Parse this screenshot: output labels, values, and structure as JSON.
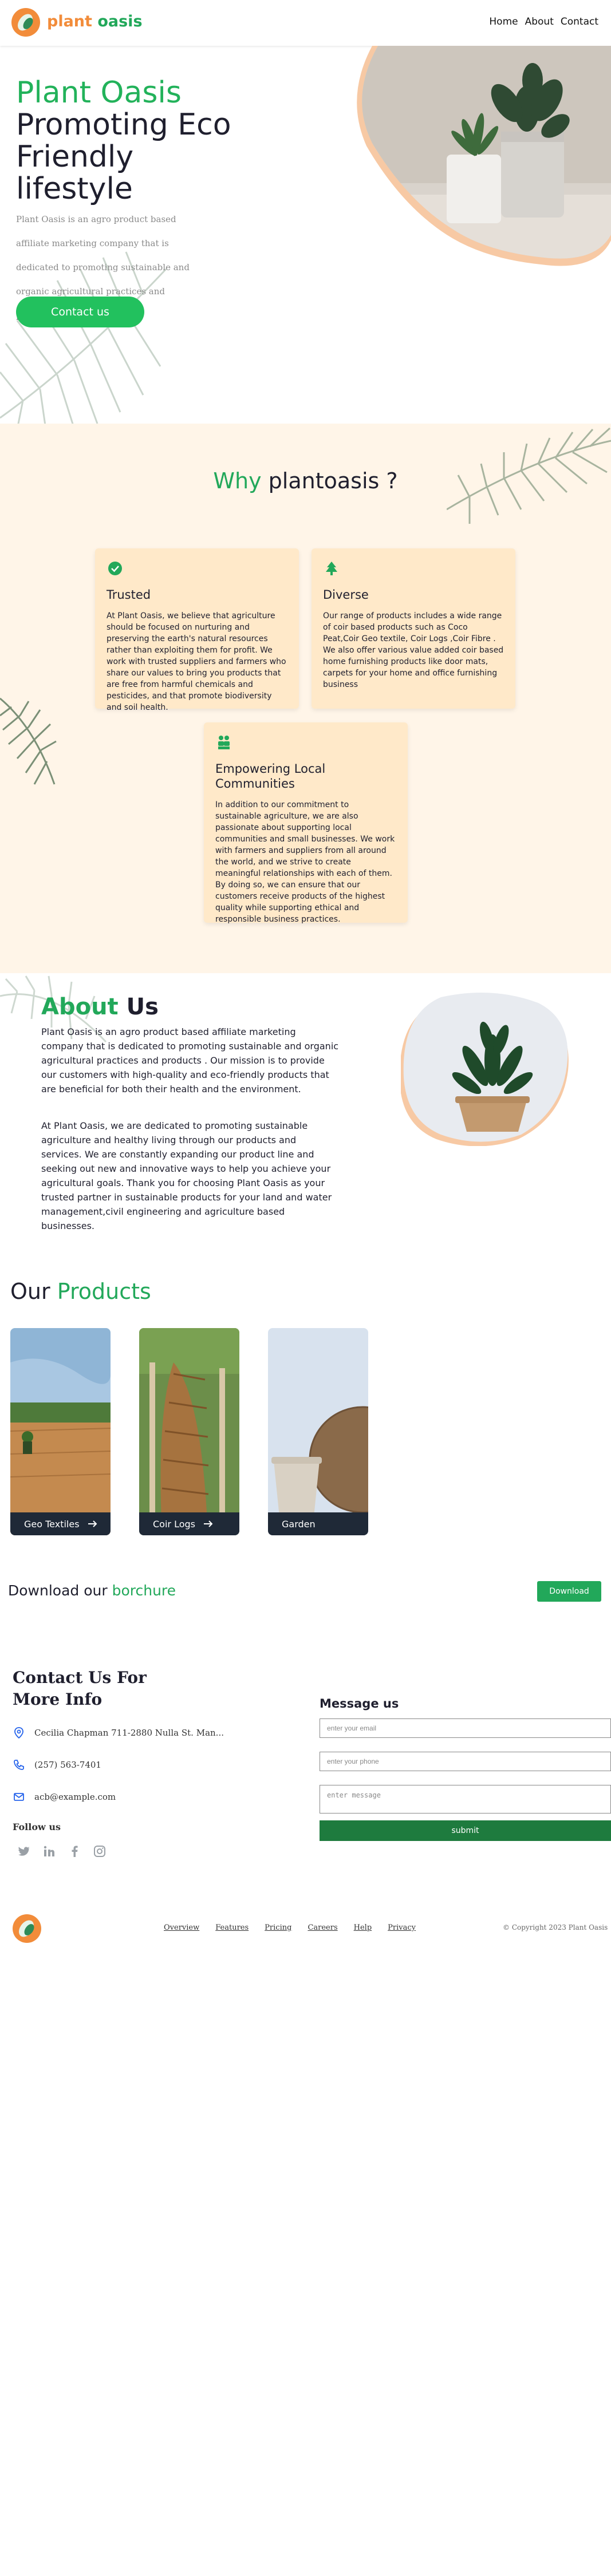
{
  "header": {
    "brand_part1": "plant",
    "brand_part2": "oasis",
    "nav": [
      "Home",
      "About",
      "Contact"
    ]
  },
  "hero": {
    "title_green": "Plant Oasis",
    "title_dark": "Promoting Eco Friendly lifestyle",
    "description": "Plant Oasis is an agro product based affiliate marketing company that is dedicated to promoting sustainable and organic agricultural practices and products .",
    "button": "Contact us"
  },
  "why": {
    "title_green": "Why",
    "title_dark": "plantoasis ?",
    "cards": [
      {
        "icon": "check-circle-icon",
        "title": "Trusted",
        "text": "At Plant Oasis, we believe that agriculture should be focused on nurturing and preserving the earth's natural resources rather than exploiting them for profit. We work with trusted suppliers and farmers who share our values to bring you products that are free from harmful chemicals and pesticides, and that promote biodiversity and soil health."
      },
      {
        "icon": "tree-icon",
        "title": "Diverse",
        "text": "Our range of products includes a wide range of coir based products such as Coco Peat,Coir Geo textile, Coir Logs ,Coir Fibre . We also offer various value added coir based home furnishing products like door mats, carpets for your home and office furnishing business"
      },
      {
        "icon": "people-icon",
        "title": "Empowering Local Communities",
        "text": "In addition to our commitment to sustainable agriculture, we are also passionate about supporting local communities and small businesses. We work with farmers and suppliers from all around the world, and we strive to create meaningful relationships with each of them. By doing so, we can ensure that our customers receive products of the highest quality while supporting ethical and responsible business practices."
      }
    ]
  },
  "about": {
    "title_green": "About",
    "title_dark": "Us",
    "para1": "Plant Oasis is an agro product based affiliate marketing company that is dedicated to promoting sustainable and organic agricultural practices and products . Our mission is to provide our customers with high-quality and eco-friendly products that are beneficial for both their health and the environment.",
    "para2": "At Plant Oasis, we are dedicated to promoting sustainable agriculture and healthy living through our products and services. We are constantly expanding our product line and seeking out new and innovative ways to help you achieve your agricultural goals. Thank you for choosing Plant Oasis as your trusted partner in sustainable products for your land and water management,civil engineering and agriculture based businesses."
  },
  "products": {
    "title_dark": "Our",
    "title_green": "Products",
    "items": [
      {
        "label": "Geo Textiles"
      },
      {
        "label": "Coir Logs"
      },
      {
        "label": "Garden"
      }
    ]
  },
  "download": {
    "text_dark": "Download our",
    "text_green": "borchure",
    "button": "Download"
  },
  "contact": {
    "title": "Contact Us For More Info",
    "address": "Cecilia Chapman 711-2880 Nulla St. Man...",
    "phone": "(257) 563-7401",
    "email": "acb@example.com",
    "follow": "Follow us",
    "socials": [
      "twitter-icon",
      "linkedin-icon",
      "facebook-icon",
      "instagram-icon"
    ],
    "message_title": "Message us",
    "email_placeholder": "enter your email",
    "phone_placeholder": "enter your phone",
    "message_placeholder": "enter message",
    "submit": "submit"
  },
  "footer": {
    "links": [
      "Overview",
      "Features",
      "Pricing",
      "Careers",
      "Help",
      "Privacy"
    ],
    "copyright": "© Copyright 2023 Plant Oasis"
  },
  "colors": {
    "brand_green": "#22a85a",
    "brand_orange": "#f28c3a",
    "section_bg": "#fff5e8",
    "card_bg": "#ffe9c9",
    "submit_green": "#1e7b3e"
  }
}
